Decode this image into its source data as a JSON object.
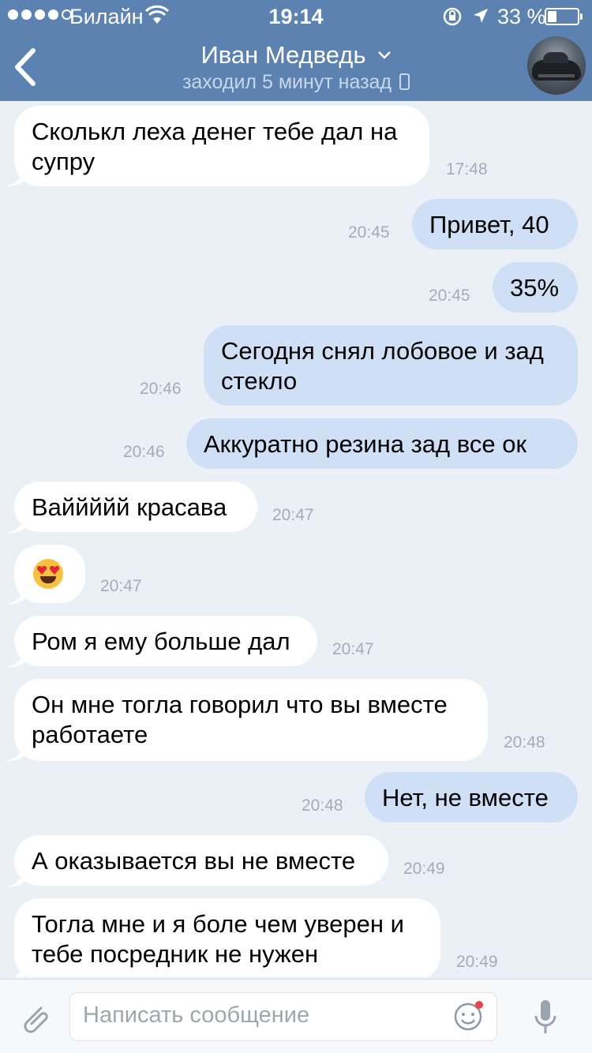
{
  "status_bar": {
    "carrier": "Билайн",
    "time": "19:14",
    "battery_percent": "33 %"
  },
  "header": {
    "contact_name": "Иван Медведь",
    "last_seen": "заходил 5 минут назад"
  },
  "messages": [
    {
      "dir": "in",
      "lines": [
        "Сколькл леха денег тебе дал на",
        "супру"
      ],
      "time": "17:48"
    },
    {
      "dir": "out",
      "lines": [
        "Привет, 40"
      ],
      "time": "20:45"
    },
    {
      "dir": "out",
      "lines": [
        "35%"
      ],
      "time": "20:45"
    },
    {
      "dir": "out",
      "lines": [
        "Сегодня снял лобовое и зад",
        "стекло"
      ],
      "time": "20:46"
    },
    {
      "dir": "out",
      "lines": [
        "Аккуратно  резина зад все ок"
      ],
      "time": "20:46"
    },
    {
      "dir": "in",
      "lines": [
        "Ваййййй красава"
      ],
      "time": "20:47"
    },
    {
      "dir": "in",
      "emoji": "heart-eyes",
      "time": "20:47"
    },
    {
      "dir": "in",
      "lines": [
        "Ром я ему больше дал"
      ],
      "time": "20:47"
    },
    {
      "dir": "in",
      "lines": [
        "Он мне тогла говорил что вы вместе",
        "работаете"
      ],
      "time": "20:48"
    },
    {
      "dir": "out",
      "lines": [
        "Нет, не вместе"
      ],
      "time": "20:48"
    },
    {
      "dir": "in",
      "lines": [
        "А оказывается вы не вместе"
      ],
      "time": "20:49"
    },
    {
      "dir": "in",
      "lines": [
        "Тогла мне и я боле чем уверен и",
        "тебе посредник не нужен"
      ],
      "time": "20:49"
    }
  ],
  "composer": {
    "placeholder": "Написать сообщение"
  },
  "colors": {
    "header_bg": "#5b82b1",
    "chat_bg": "#ebf0f6",
    "incoming_bubble": "#ffffff",
    "outgoing_bubble": "#cfe0f6",
    "timestamp": "#a3adb9"
  }
}
